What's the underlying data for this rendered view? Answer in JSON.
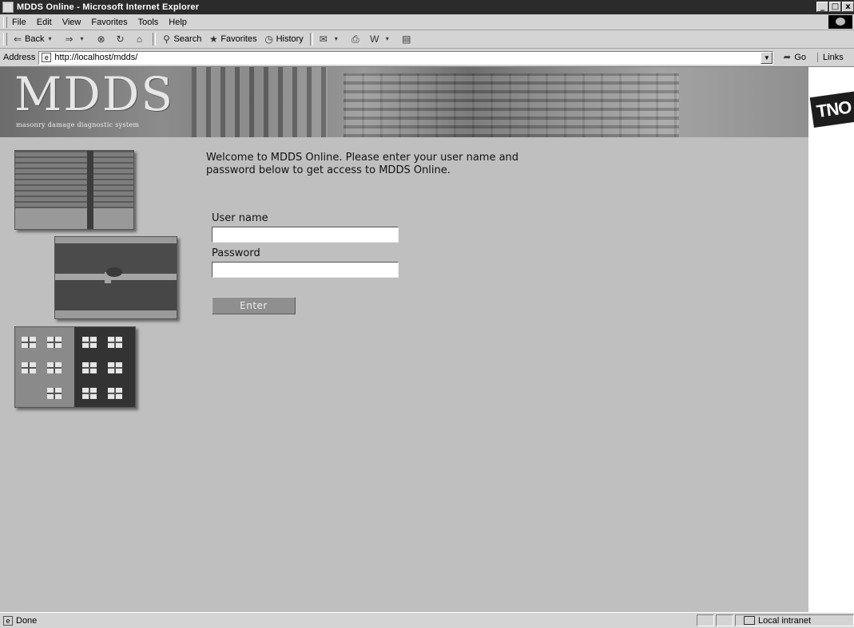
{
  "window": {
    "title": "MDDS Online - Microsoft Internet Explorer",
    "controls": [
      "_",
      "□",
      "x"
    ]
  },
  "menu": {
    "items": [
      "File",
      "Edit",
      "View",
      "Favorites",
      "Tools",
      "Help"
    ]
  },
  "toolbar": {
    "back": "Back",
    "forward_icon": "⇒",
    "stop_icon": "⊗",
    "refresh_icon": "↻",
    "home_icon": "⌂",
    "search": "Search",
    "favorites": "Favorites",
    "history": "History"
  },
  "address": {
    "label": "Address",
    "url": "http://localhost/mdds/",
    "go": "Go",
    "links": "Links"
  },
  "banner": {
    "logo": "MDDS",
    "tagline": "masonry damage diagnostic system",
    "partner_logo": "TNO"
  },
  "login": {
    "welcome": "Welcome to MDDS Online. Please enter your user name and password below to get access to MDDS Online.",
    "username_label": "User name",
    "username_value": "",
    "password_label": "Password",
    "password_value": "",
    "enter": "Enter"
  },
  "status": {
    "text": "Done",
    "zone": "Local intranet"
  }
}
